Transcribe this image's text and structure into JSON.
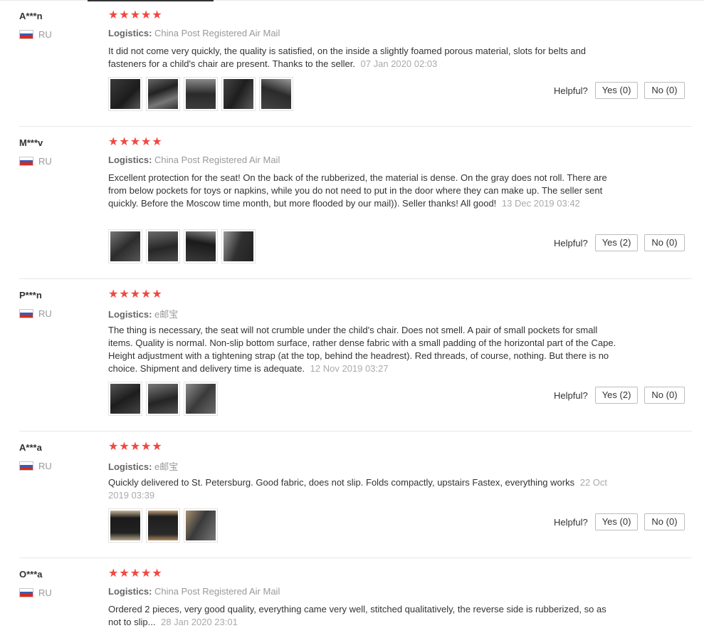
{
  "helpful_label": "Helpful?",
  "logistics_label": "Logistics:",
  "star_glyph": "★",
  "reviews": [
    {
      "user": "A***n",
      "country": "RU",
      "logistics": "China Post Registered Air Mail",
      "text": "It did not come very quickly, the quality is satisfied, on the inside a slightly foamed porous material, slots for belts and fasteners for a child's chair are present. Thanks to the seller.",
      "date": "07 Jan 2020 02:03",
      "rating": 5,
      "yes": "Yes (0)",
      "no": "No (0)",
      "photos": 5
    },
    {
      "user": "M***v",
      "country": "RU",
      "logistics": "China Post Registered Air Mail",
      "text": "Excellent protection for the seat! On the back of the rubberized, the material is dense. On the gray does not roll. There are from below pockets for toys or napkins, while you do not need to put in the door where they can make up. The seller sent quickly. Before the Moscow time month, but more flooded by our mail)). Seller thanks! All good!",
      "date": "13 Dec 2019 03:42",
      "rating": 5,
      "yes": "Yes (2)",
      "no": "No (0)",
      "photos": 4
    },
    {
      "user": "P***n",
      "country": "RU",
      "logistics": "e邮宝",
      "text": "The thing is necessary, the seat will not crumble under the child's chair. Does not smell. A pair of small pockets for small items. Quality is normal. Non-slip bottom surface, rather dense fabric with a small padding of the horizontal part of the Cape. Height adjustment with a tightening strap (at the top, behind the headrest). Red threads, of course, nothing. But there is no choice. Shipment and delivery time is adequate.",
      "date": "12 Nov 2019 03:27",
      "rating": 5,
      "yes": "Yes (2)",
      "no": "No (0)",
      "photos": 3
    },
    {
      "user": "A***a",
      "country": "RU",
      "logistics": "e邮宝",
      "text": "Quickly delivered to St. Petersburg. Good fabric, does not slip. Folds compactly, upstairs Fastex, everything works",
      "date": "22 Oct 2019 03:39",
      "rating": 5,
      "yes": "Yes (0)",
      "no": "No (0)",
      "photos": 3
    },
    {
      "user": "O***a",
      "country": "RU",
      "logistics": "China Post Registered Air Mail",
      "text": "Ordered 2 pieces, very good quality, everything came very well, stitched qualitatively, the reverse side is rubberized, so as not to slip...",
      "date": "28 Jan 2020 23:01",
      "rating": 5
    }
  ],
  "colors": {
    "star": "#f0483e",
    "muted": "#999999",
    "separator": "#e8e8e8"
  }
}
